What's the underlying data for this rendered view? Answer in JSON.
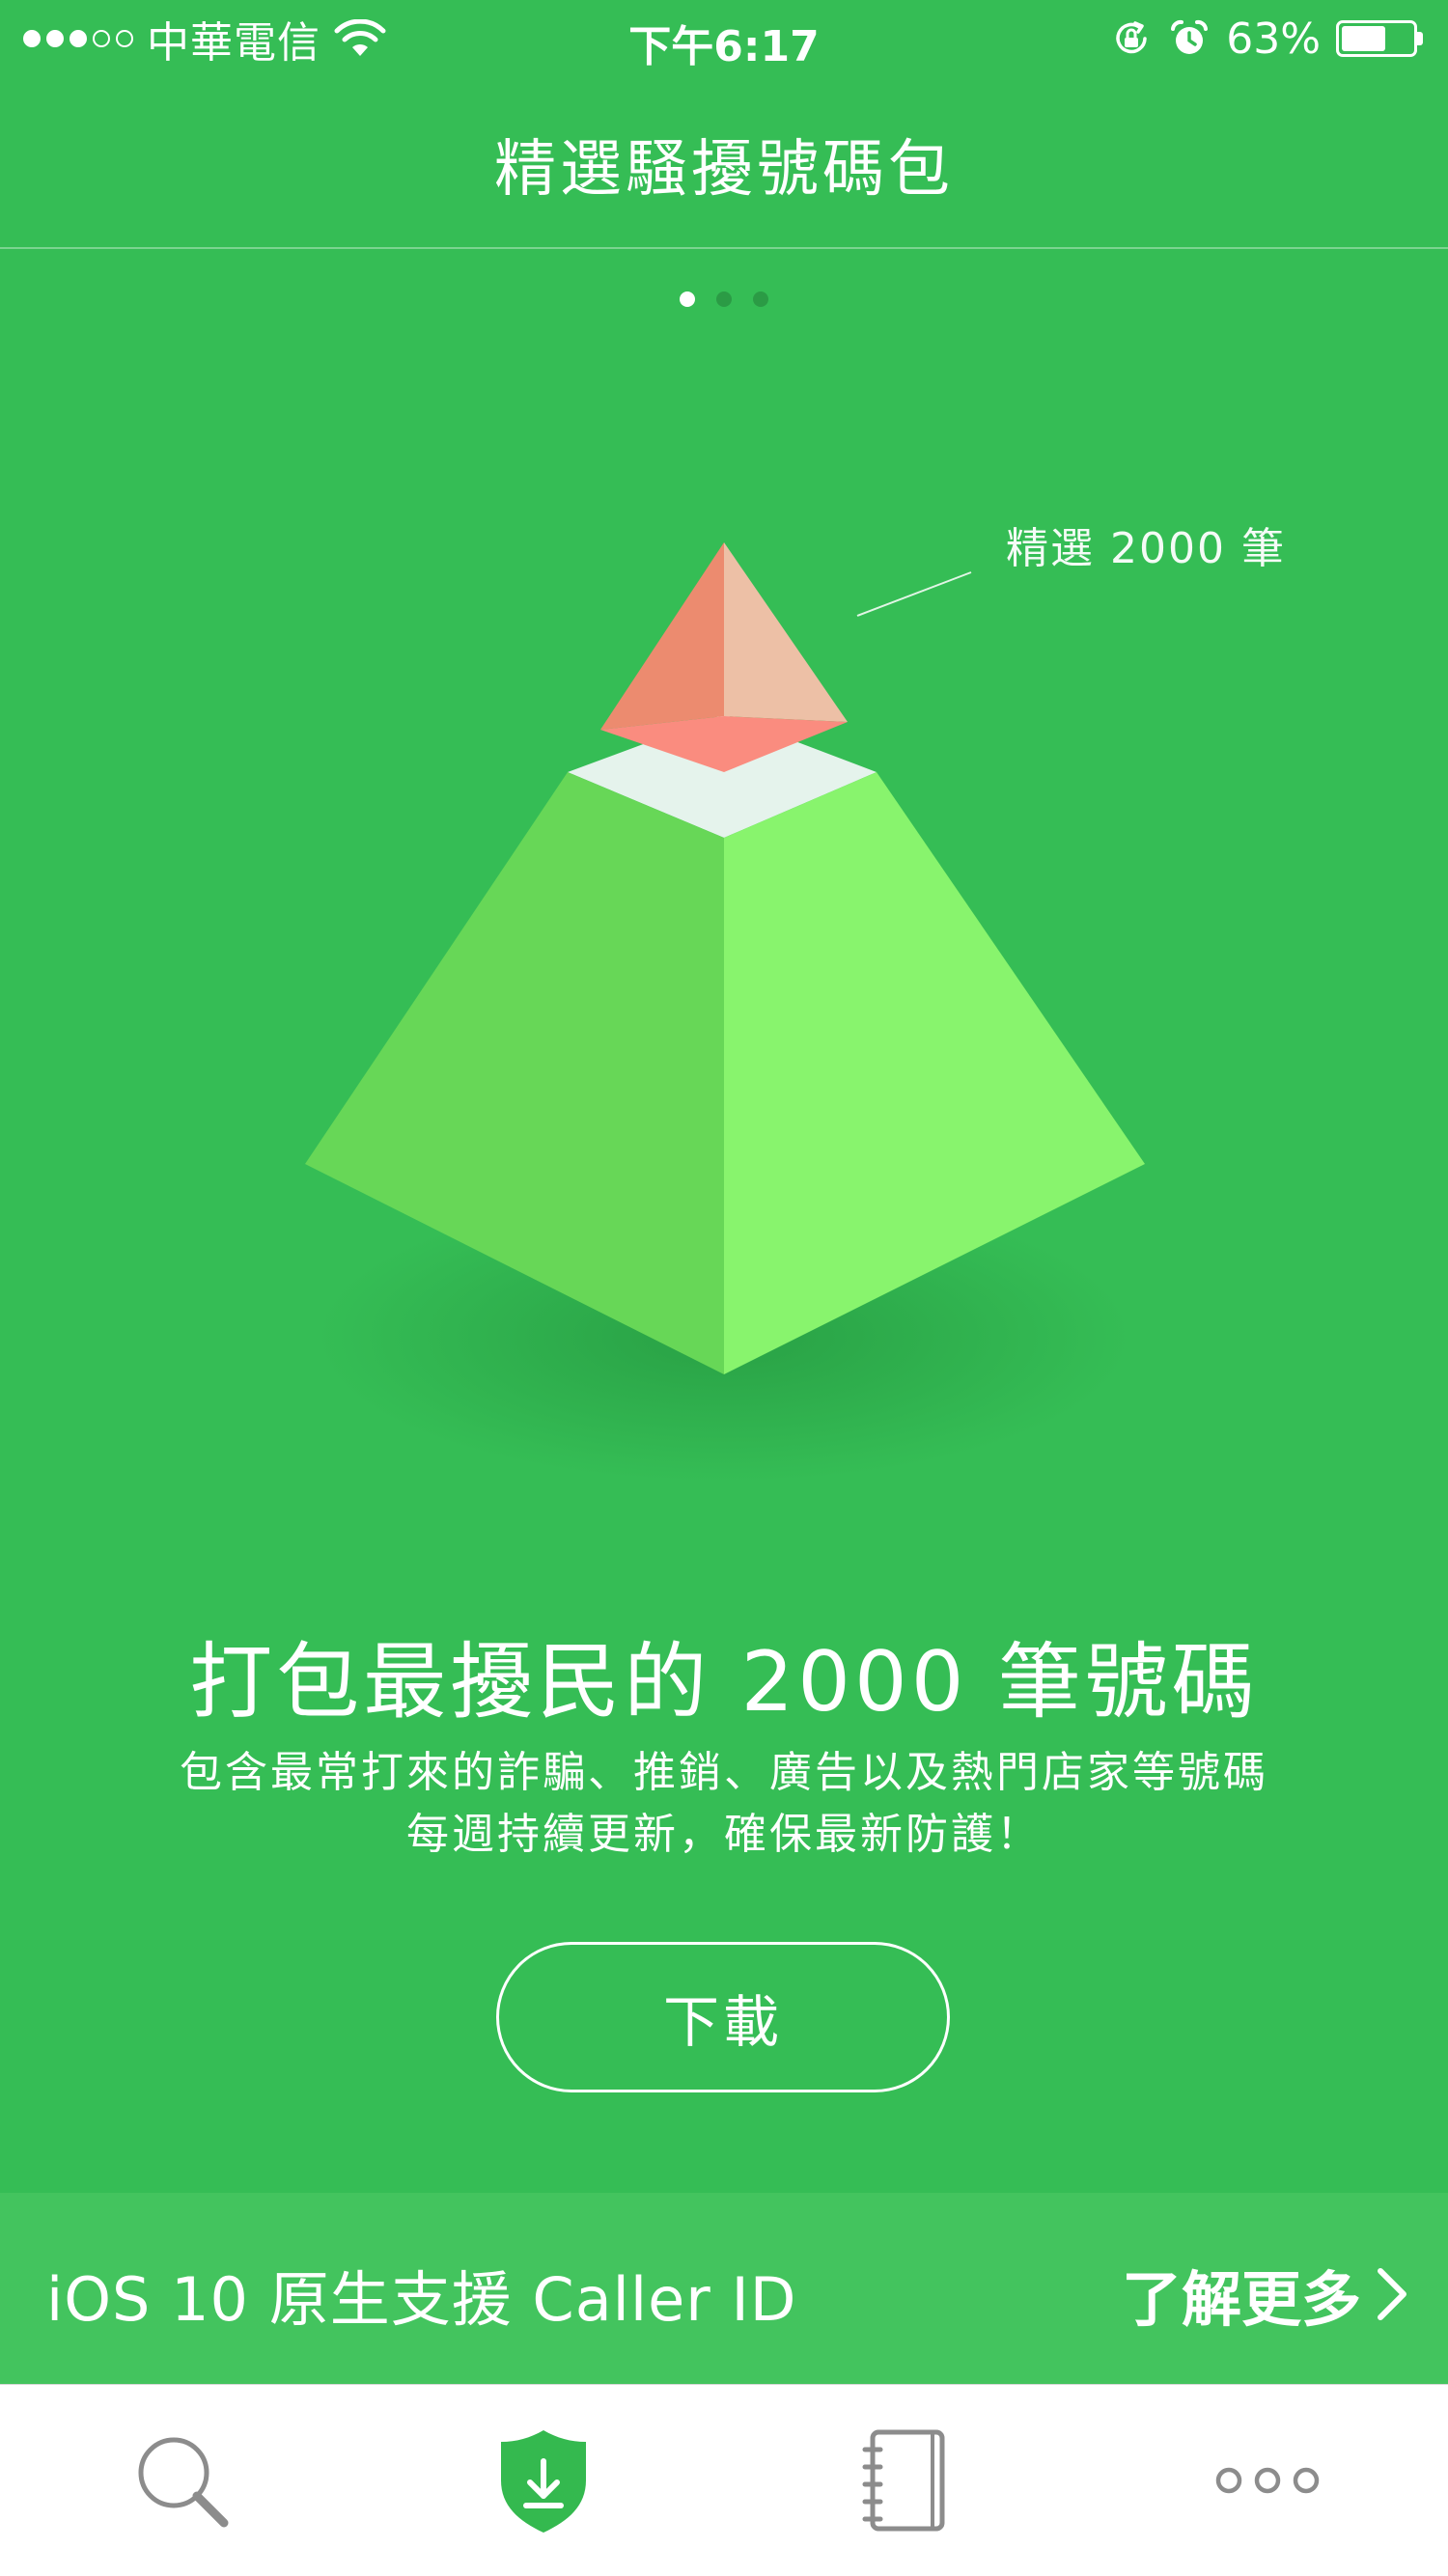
{
  "status_bar": {
    "carrier": "中華電信",
    "time": "下午6:17",
    "battery_percent": "63%",
    "battery_level": 0.63,
    "signal_bars_filled": 3,
    "signal_bars_total": 5
  },
  "nav": {
    "title": "精選騷擾號碼包"
  },
  "pager": {
    "page_count": 3,
    "current_page": 1
  },
  "illustration": {
    "callout_label": "精選 2000 筆"
  },
  "main": {
    "headline": "打包最擾民的 2000 筆號碼",
    "description_line1": "包含最常打來的詐騙、推銷、廣告以及熱門店家等號碼",
    "description_line2": "每週持續更新，確保最新防護！",
    "download_label": "下載"
  },
  "promo": {
    "text": "iOS 10 原生支援 Caller ID",
    "link_label": "了解更多"
  },
  "tabbar": {
    "tabs": [
      {
        "icon": "search-icon",
        "active": false
      },
      {
        "icon": "shield-download-icon",
        "active": true
      },
      {
        "icon": "notebook-icon",
        "active": false
      },
      {
        "icon": "more-dots-icon",
        "active": false
      }
    ]
  },
  "colors": {
    "background": "#35bd55",
    "promo_background": "#43c45e",
    "active_tab": "#34b94f",
    "inactive_tab": "#8c8c8c"
  }
}
